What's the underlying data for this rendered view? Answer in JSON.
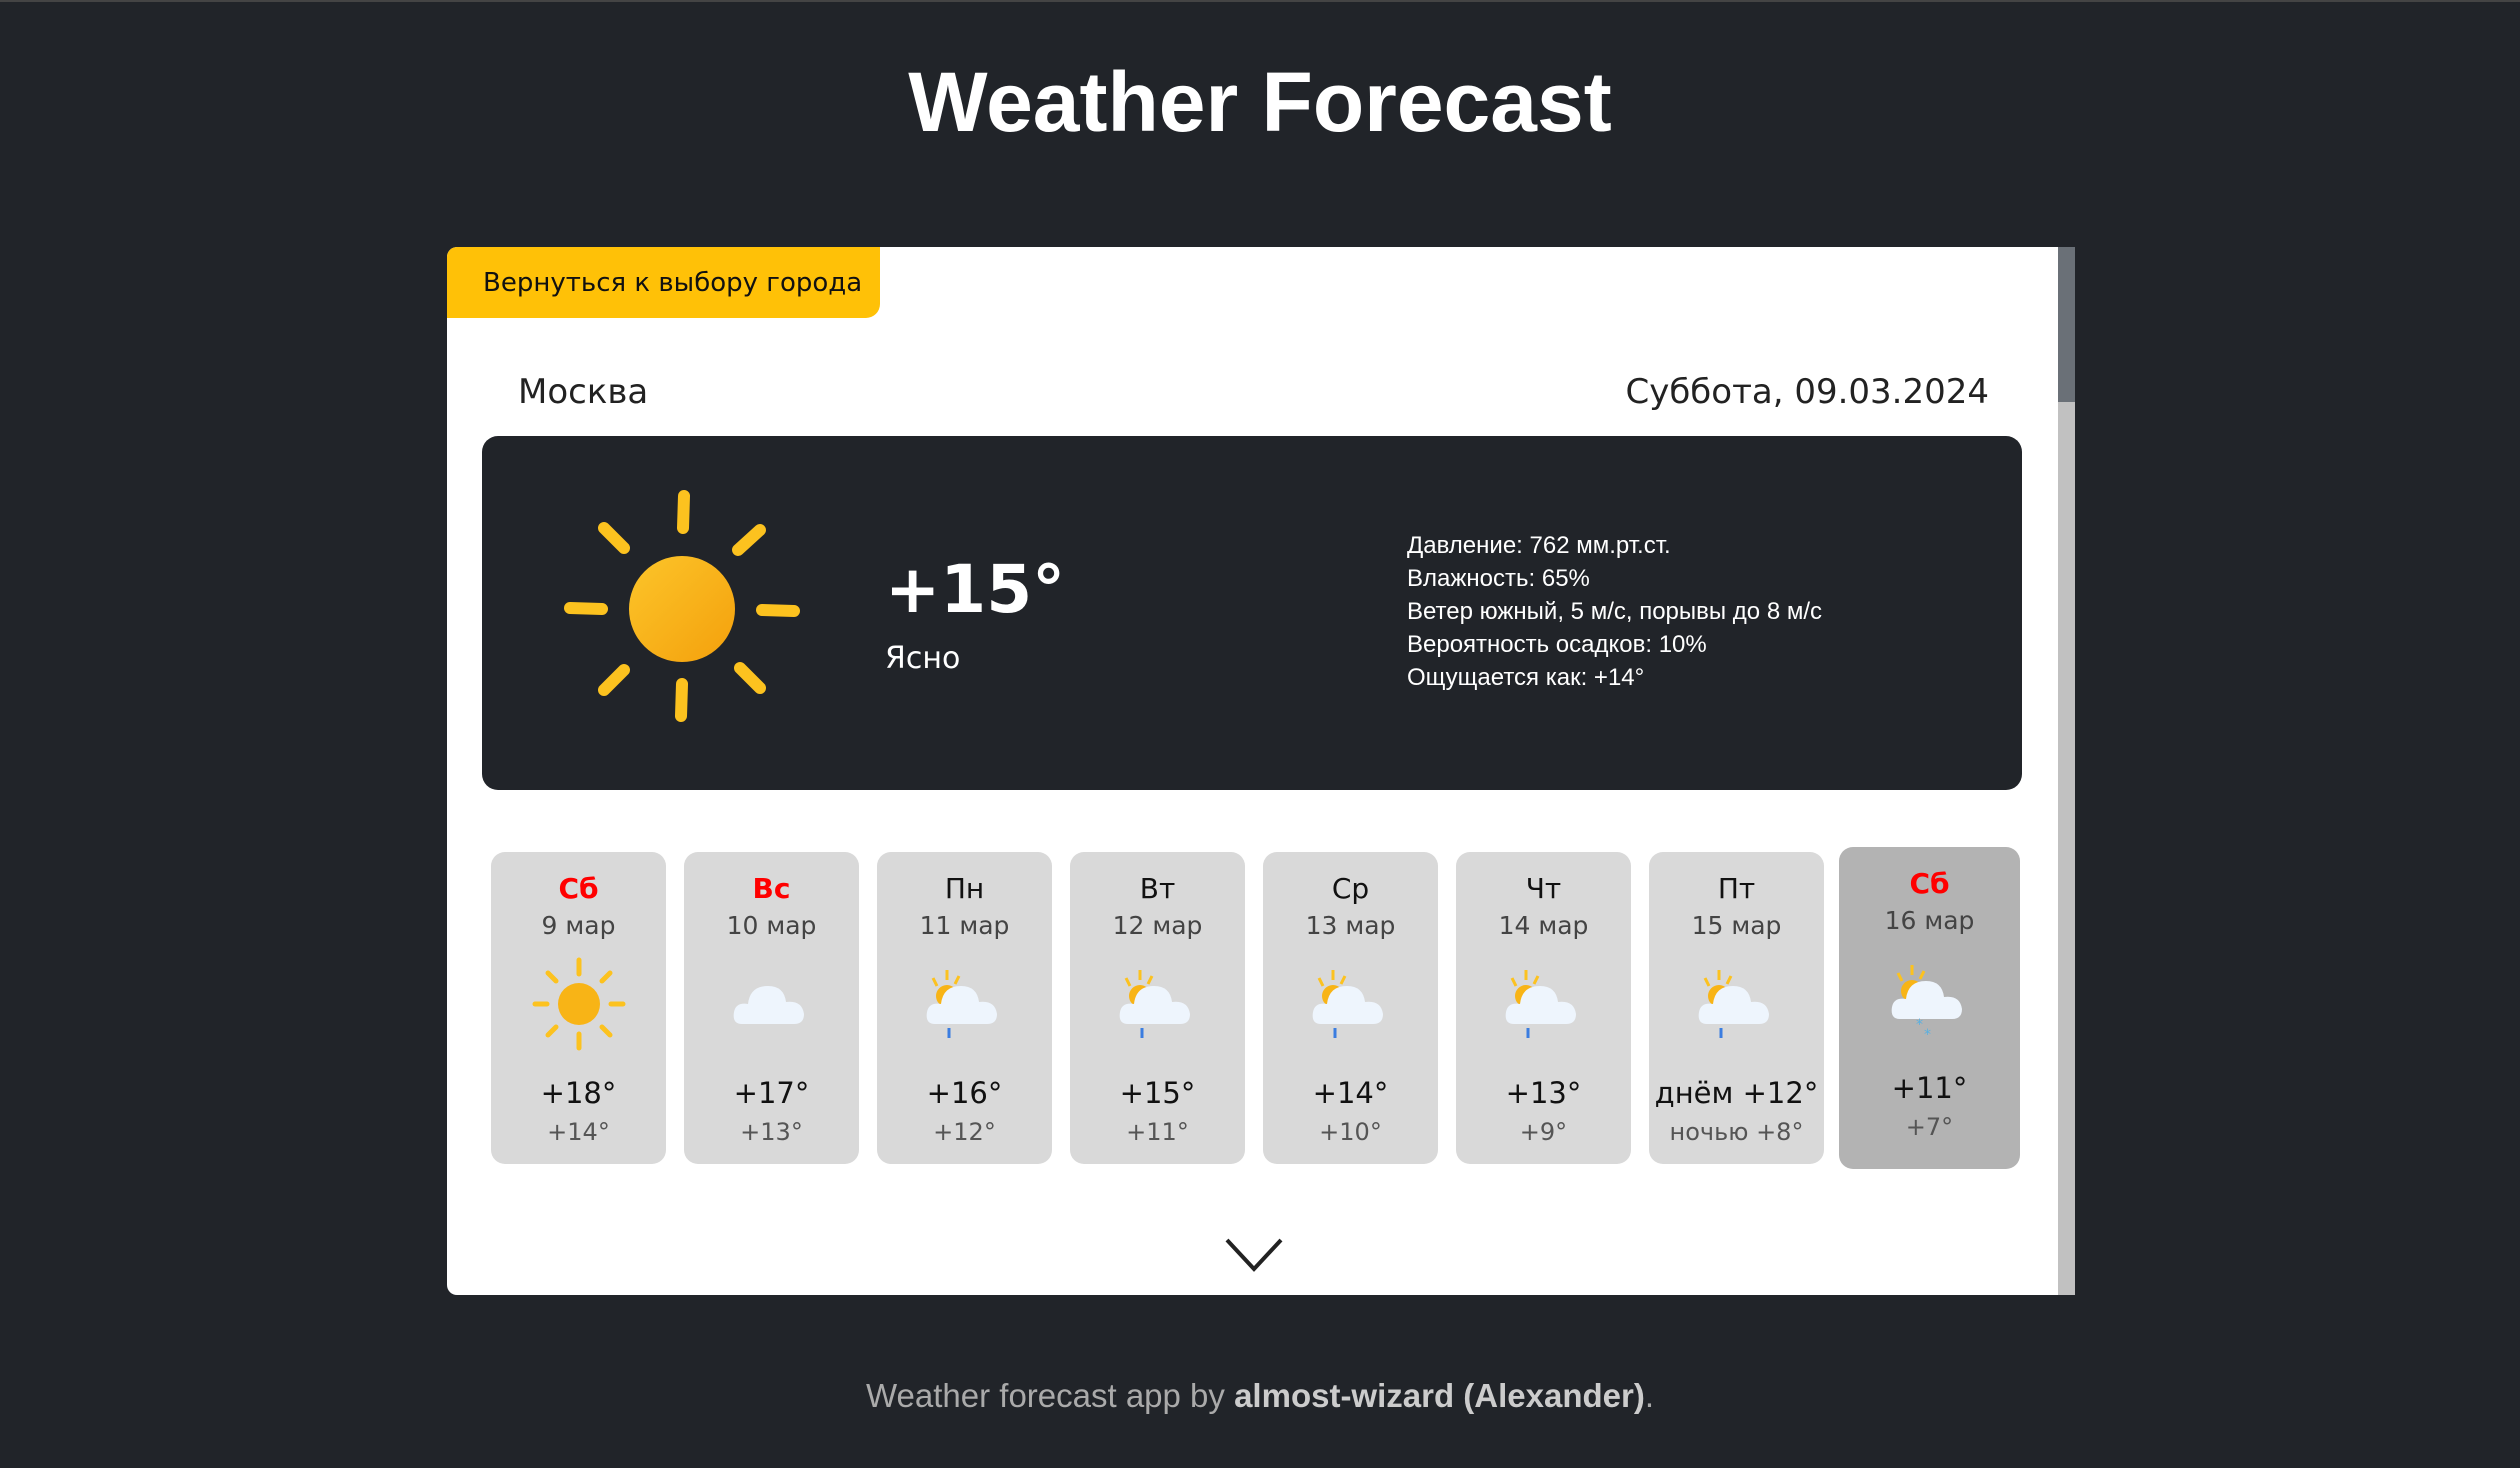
{
  "title": "Weather Forecast",
  "back_button": "Вернуться к выбору города",
  "city": "Москва",
  "date": "Суббота, 09.03.2024",
  "current": {
    "temp": "+15°",
    "condition": "Ясно",
    "icon": "sun-icon",
    "details": [
      "Давление: 762 мм.рт.ст.",
      "Влажность: 65%",
      "Ветер южный, 5 м/с, порывы до 8 м/с",
      "Вероятность осадков: 10%",
      "Ощущается как: +14°"
    ]
  },
  "days": [
    {
      "name": "Сб",
      "date": "9 мар",
      "hi": "+18°",
      "lo": "+14°",
      "icon": "sun",
      "weekend": true
    },
    {
      "name": "Вс",
      "date": "10 мар",
      "hi": "+17°",
      "lo": "+13°",
      "icon": "cloud",
      "weekend": true
    },
    {
      "name": "Пн",
      "date": "11 мар",
      "hi": "+16°",
      "lo": "+12°",
      "icon": "rain"
    },
    {
      "name": "Вт",
      "date": "12 мар",
      "hi": "+15°",
      "lo": "+11°",
      "icon": "rain"
    },
    {
      "name": "Ср",
      "date": "13 мар",
      "hi": "+14°",
      "lo": "+10°",
      "icon": "rain"
    },
    {
      "name": "Чт",
      "date": "14 мар",
      "hi": "+13°",
      "lo": "+9°",
      "icon": "rain"
    },
    {
      "name": "Пт",
      "date": "15 мар",
      "hi": "днём +12°",
      "lo": "ночью +8°",
      "icon": "rain"
    },
    {
      "name": "Сб",
      "date": "16 мар",
      "hi": "+11°",
      "lo": "+7°",
      "icon": "snow",
      "weekend": true,
      "selected": true
    }
  ],
  "footer": {
    "prefix": "Weather forecast app by ",
    "author": "almost-wizard (Alexander)",
    "suffix": "."
  },
  "colors": {
    "accent": "#ffc107",
    "bg": "#212429",
    "weekend": "#ff0000"
  }
}
